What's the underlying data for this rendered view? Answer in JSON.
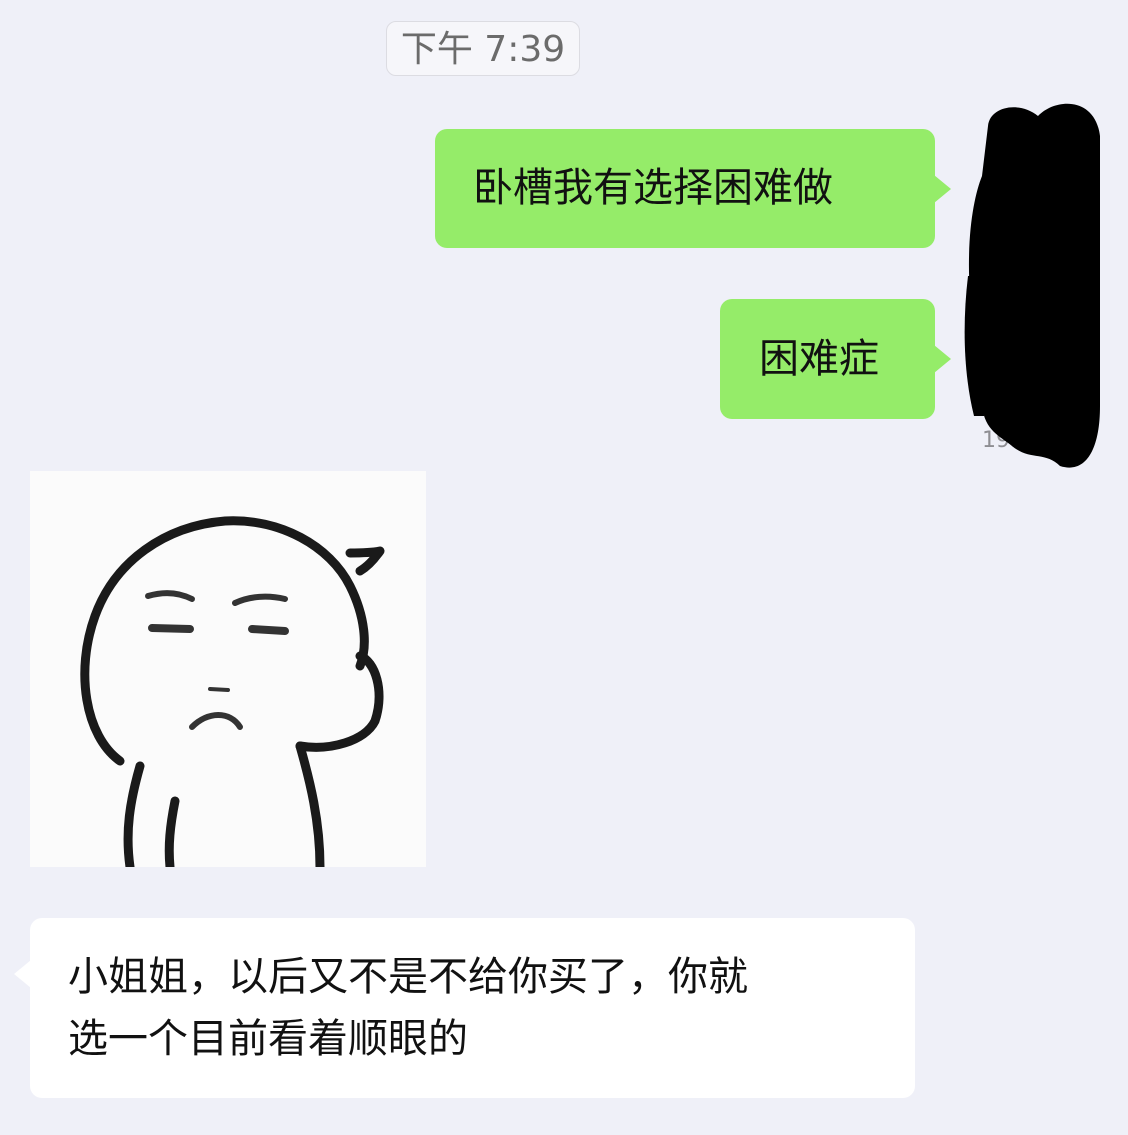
{
  "chat": {
    "time_divider": "下午 7:39",
    "messages": [
      {
        "side": "outgoing",
        "text": "卧槽我有选择困难做"
      },
      {
        "side": "outgoing",
        "text": "困难症"
      },
      {
        "side": "incoming",
        "type": "sticker",
        "sticker": "thinking-face-sticker"
      },
      {
        "side": "incoming",
        "lines": [
          "小姐姐，以后又不是不给你买了，你就",
          "选一个目前看着顺眼的"
        ]
      }
    ],
    "read_time": "19:3"
  },
  "colors": {
    "background": "#EFF0F8",
    "outgoing_bubble": "#95EC69",
    "incoming_bubble": "#FFFFFF",
    "redaction": "#000000"
  }
}
